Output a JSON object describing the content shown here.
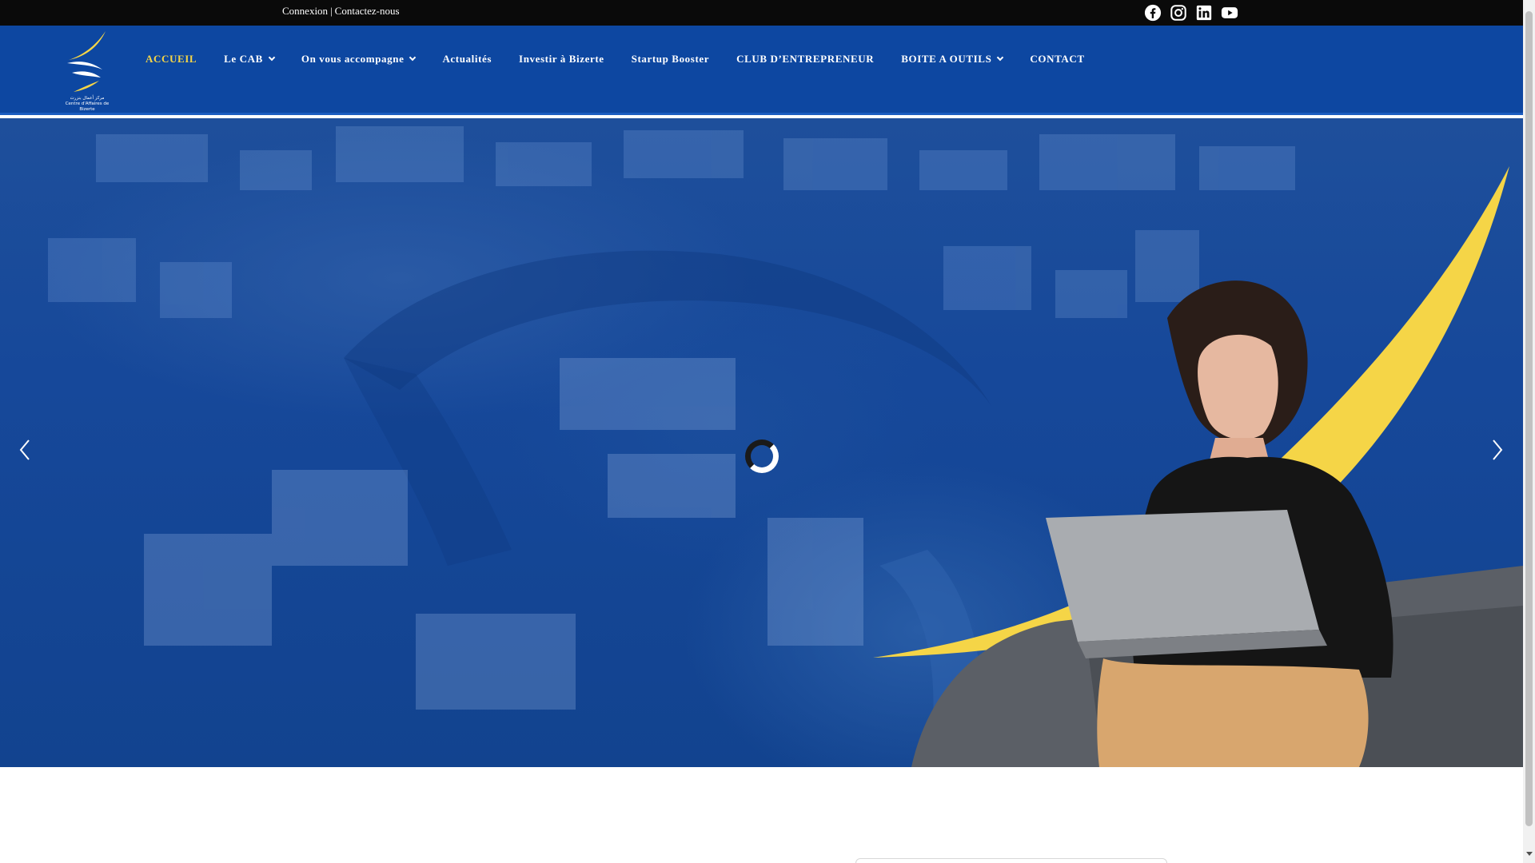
{
  "topbar": {
    "links": [
      {
        "label": "Connexion"
      },
      {
        "label": "Contactez-nous"
      }
    ],
    "separator": "|",
    "social": [
      "facebook-icon",
      "instagram-icon",
      "linkedin-icon",
      "youtube-icon"
    ]
  },
  "logo": {
    "caption_ar": "مركز أعمال بنزرت",
    "caption_fr": "Centre d'Affaires de Bizerte"
  },
  "nav": {
    "items": [
      {
        "label": "ACCUEIL",
        "active": true,
        "dropdown": false
      },
      {
        "label": "Le CAB",
        "active": false,
        "dropdown": true
      },
      {
        "label": "On vous accompagne",
        "active": false,
        "dropdown": true
      },
      {
        "label": "Actualités",
        "active": false,
        "dropdown": false
      },
      {
        "label": "Investir à Bizerte",
        "active": false,
        "dropdown": false
      },
      {
        "label": "Startup Booster",
        "active": false,
        "dropdown": false
      },
      {
        "label": "CLUB D’ENTREPRENEUR",
        "active": false,
        "dropdown": false
      },
      {
        "label": "BOITE A OUTILS",
        "active": false,
        "dropdown": true
      },
      {
        "label": "CONTACT",
        "active": false,
        "dropdown": false
      }
    ]
  },
  "hero": {
    "arrows": [
      "chevron-left-icon",
      "chevron-right-icon"
    ],
    "loading": true
  },
  "colors": {
    "topbar": "#0a0a0a",
    "header": "#0d47a1",
    "accent": "#f5d547",
    "hero_overlay": "#16489a"
  }
}
